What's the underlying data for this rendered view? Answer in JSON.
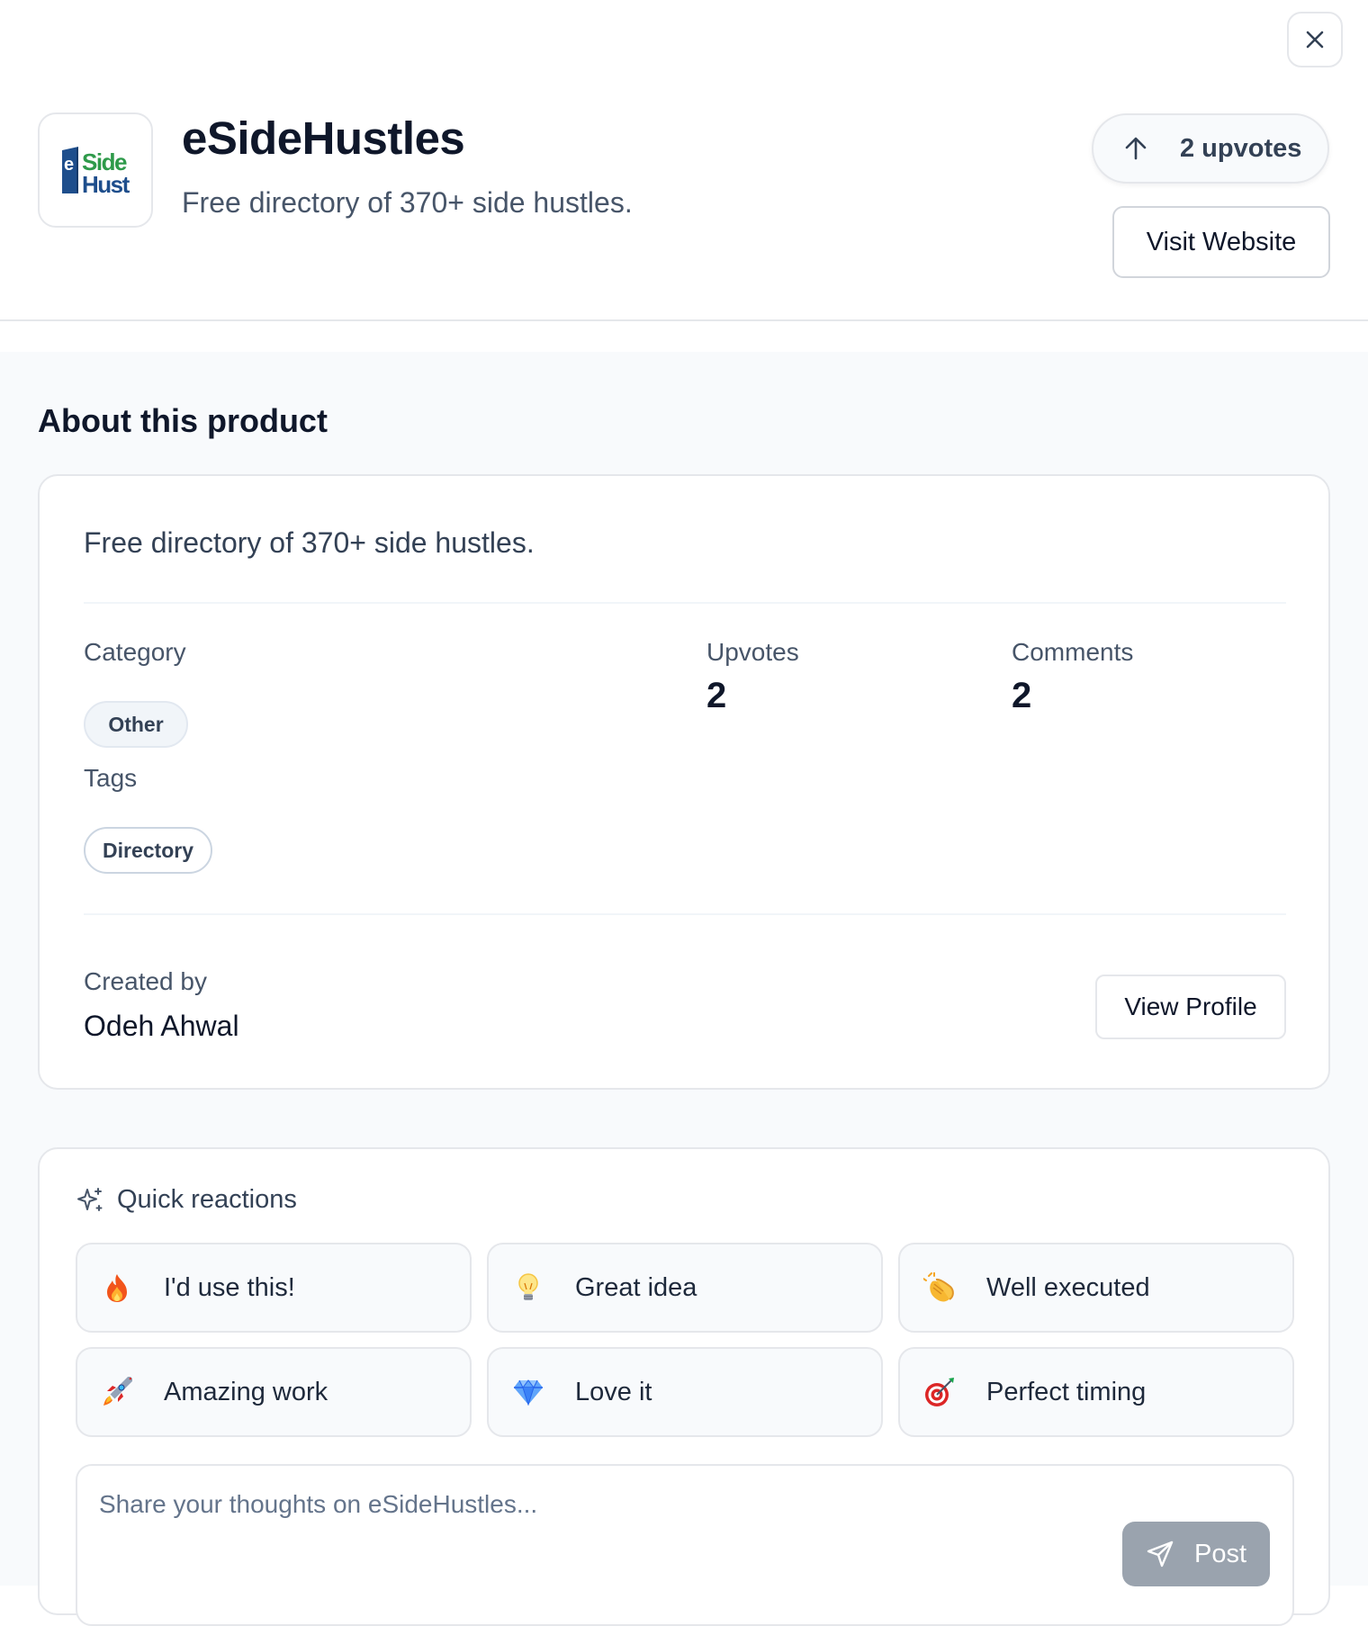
{
  "product": {
    "name": "eSideHustles",
    "tagline": "Free directory of 370+ side hustles.",
    "logo_icon": "eside-hustles-logo",
    "logo_text_line1": "Side",
    "logo_text_line2": "Hust"
  },
  "header": {
    "close_icon": "close-icon",
    "upvote_icon": "arrow-up-icon",
    "upvote_label": "2 upvotes",
    "visit_label": "Visit Website"
  },
  "about": {
    "section_title": "About this product",
    "description": "Free directory of 370+ side hustles.",
    "category_label": "Category",
    "category_value": "Other",
    "tags_label": "Tags",
    "tags": [
      "Directory"
    ],
    "upvotes_label": "Upvotes",
    "upvotes_value": "2",
    "comments_label": "Comments",
    "comments_value": "2",
    "created_by_label": "Created by",
    "creator_name": "Odeh Ahwal",
    "view_profile_label": "View Profile"
  },
  "reactions": {
    "title": "Quick reactions",
    "title_icon": "sparkles-icon",
    "items": [
      {
        "emoji": "fire-icon",
        "label": "I'd use this!"
      },
      {
        "emoji": "lightbulb-icon",
        "label": "Great idea"
      },
      {
        "emoji": "clapping-hands-icon",
        "label": "Well executed"
      },
      {
        "emoji": "rocket-icon",
        "label": "Amazing work"
      },
      {
        "emoji": "gem-icon",
        "label": "Love it"
      },
      {
        "emoji": "target-icon",
        "label": "Perfect timing"
      }
    ]
  },
  "comment": {
    "placeholder": "Share your thoughts on eSideHustles...",
    "value": "",
    "post_label": "Post",
    "post_icon": "send-icon"
  },
  "colors": {
    "brand_blue": "#1e4e8c",
    "brand_green": "#2e9a4a",
    "page_bg": "#f8fafc",
    "border": "#e5e7eb",
    "post_disabled": "#9aa3ae"
  }
}
